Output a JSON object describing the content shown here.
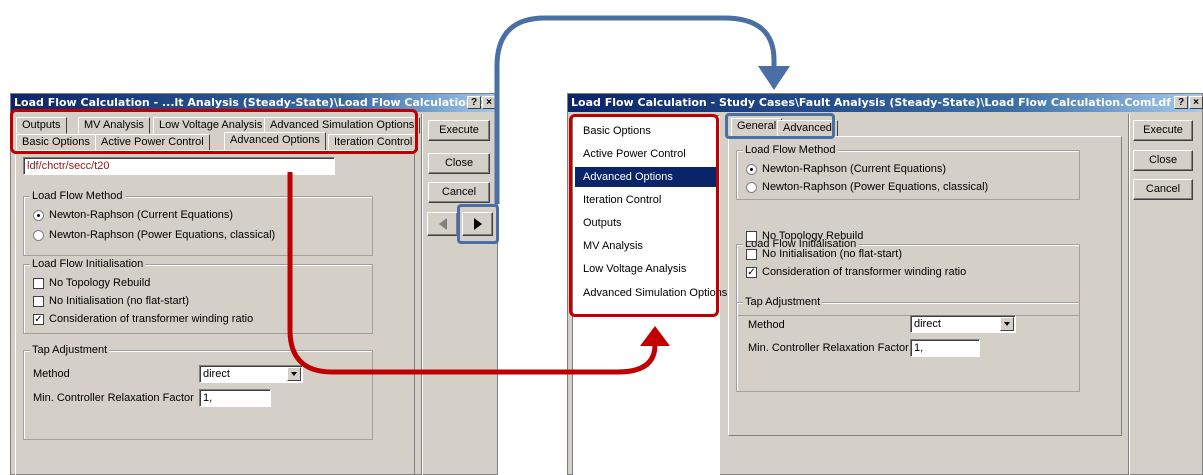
{
  "left": {
    "title": "Load Flow Calculation - ...lt Analysis (Steady-State)\\Load Flow Calculation.ComLdf",
    "help_btn": "?",
    "close_btn": "×",
    "tabs_row1": [
      "Outputs",
      "MV Analysis",
      "Low Voltage Analysis",
      "Advanced Simulation Options"
    ],
    "tabs_row2": [
      "Basic Options",
      "Active Power Control",
      "Advanced Options",
      "Iteration Control"
    ],
    "path_value": "ldf/chctr/secc/t20",
    "method_group": "Load Flow Method",
    "method_options": [
      "Newton-Raphson (Current Equations)",
      "Newton-Raphson (Power Equations, classical)"
    ],
    "init_group": "Load Flow Initialisation",
    "init_options": [
      "No Topology Rebuild",
      "No Initialisation (no flat-start)",
      "Consideration of transformer winding ratio"
    ],
    "tap_group": "Tap Adjustment",
    "method_label": "Method",
    "method_value": "direct",
    "relax_label": "Min. Controller Relaxation Factor",
    "relax_value": "1,",
    "buttons": {
      "execute": "Execute",
      "close": "Close",
      "cancel": "Cancel"
    }
  },
  "right": {
    "title": "Load Flow Calculation - Study Cases\\Fault Analysis (Steady-State)\\Load Flow Calculation.ComLdf",
    "help_btn": "?",
    "close_btn": "×",
    "nav_items": [
      "Basic Options",
      "Active Power Control",
      "Advanced Options",
      "Iteration Control",
      "Outputs",
      "MV Analysis",
      "Low Voltage Analysis",
      "Advanced Simulation Options"
    ],
    "tabs": [
      "General",
      "Advanced"
    ],
    "method_group": "Load Flow Method",
    "method_options": [
      "Newton-Raphson (Current Equations)",
      "Newton-Raphson (Power Equations, classical)"
    ],
    "init_group": "Load Flow Initialisation",
    "init_options": [
      "No Topology Rebuild",
      "No Initialisation (no flat-start)",
      "Consideration of transformer winding ratio"
    ],
    "tap_group": "Tap Adjustment",
    "method_label": "Method",
    "method_value": "direct",
    "relax_label": "Min. Controller Relaxation Factor",
    "relax_value": "1,",
    "buttons": {
      "execute": "Execute",
      "close": "Close",
      "cancel": "Cancel"
    }
  },
  "state": {
    "method_selected": 0,
    "init_checked": [
      false,
      false,
      true
    ],
    "selected_tab_left": "Advanced Options",
    "selected_nav_right": "Advanced Options",
    "selected_tab_right": "General"
  },
  "colors": {
    "highlight_red": "#c00000",
    "highlight_blue": "#4a6fa5",
    "selection": "#0a246a",
    "title_bar": "#0a246a"
  },
  "icons": {
    "prev": "triangle-left-icon",
    "next": "triangle-right-icon"
  }
}
